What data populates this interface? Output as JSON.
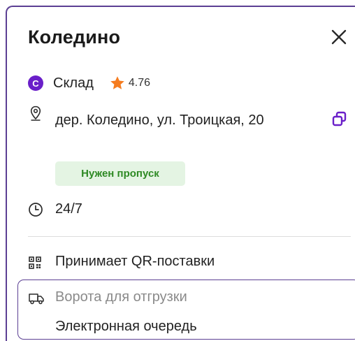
{
  "warehouse": {
    "title": "Коледино",
    "type_badge": "С",
    "type_label": "Склад",
    "rating": "4.76",
    "address": "дер. Коледино, ул. Троицкая, 20",
    "pass_required": "Нужен пропуск",
    "hours": "24/7",
    "qr_supply": "Принимает QR-поставки",
    "gates": "Ворота для отгрузки",
    "queue": "Электронная очередь"
  },
  "colors": {
    "accent": "#6a1fc9",
    "frame": "#5b3f93",
    "star": "#f57c1f",
    "pass_bg": "#e4f4e3",
    "pass_text": "#2e8a24"
  },
  "icons": {
    "close": "close-icon",
    "star": "star-icon",
    "location": "location-pin-icon",
    "copy": "copy-icon",
    "clock": "clock-icon",
    "qr": "qr-code-icon",
    "truck": "truck-icon"
  }
}
